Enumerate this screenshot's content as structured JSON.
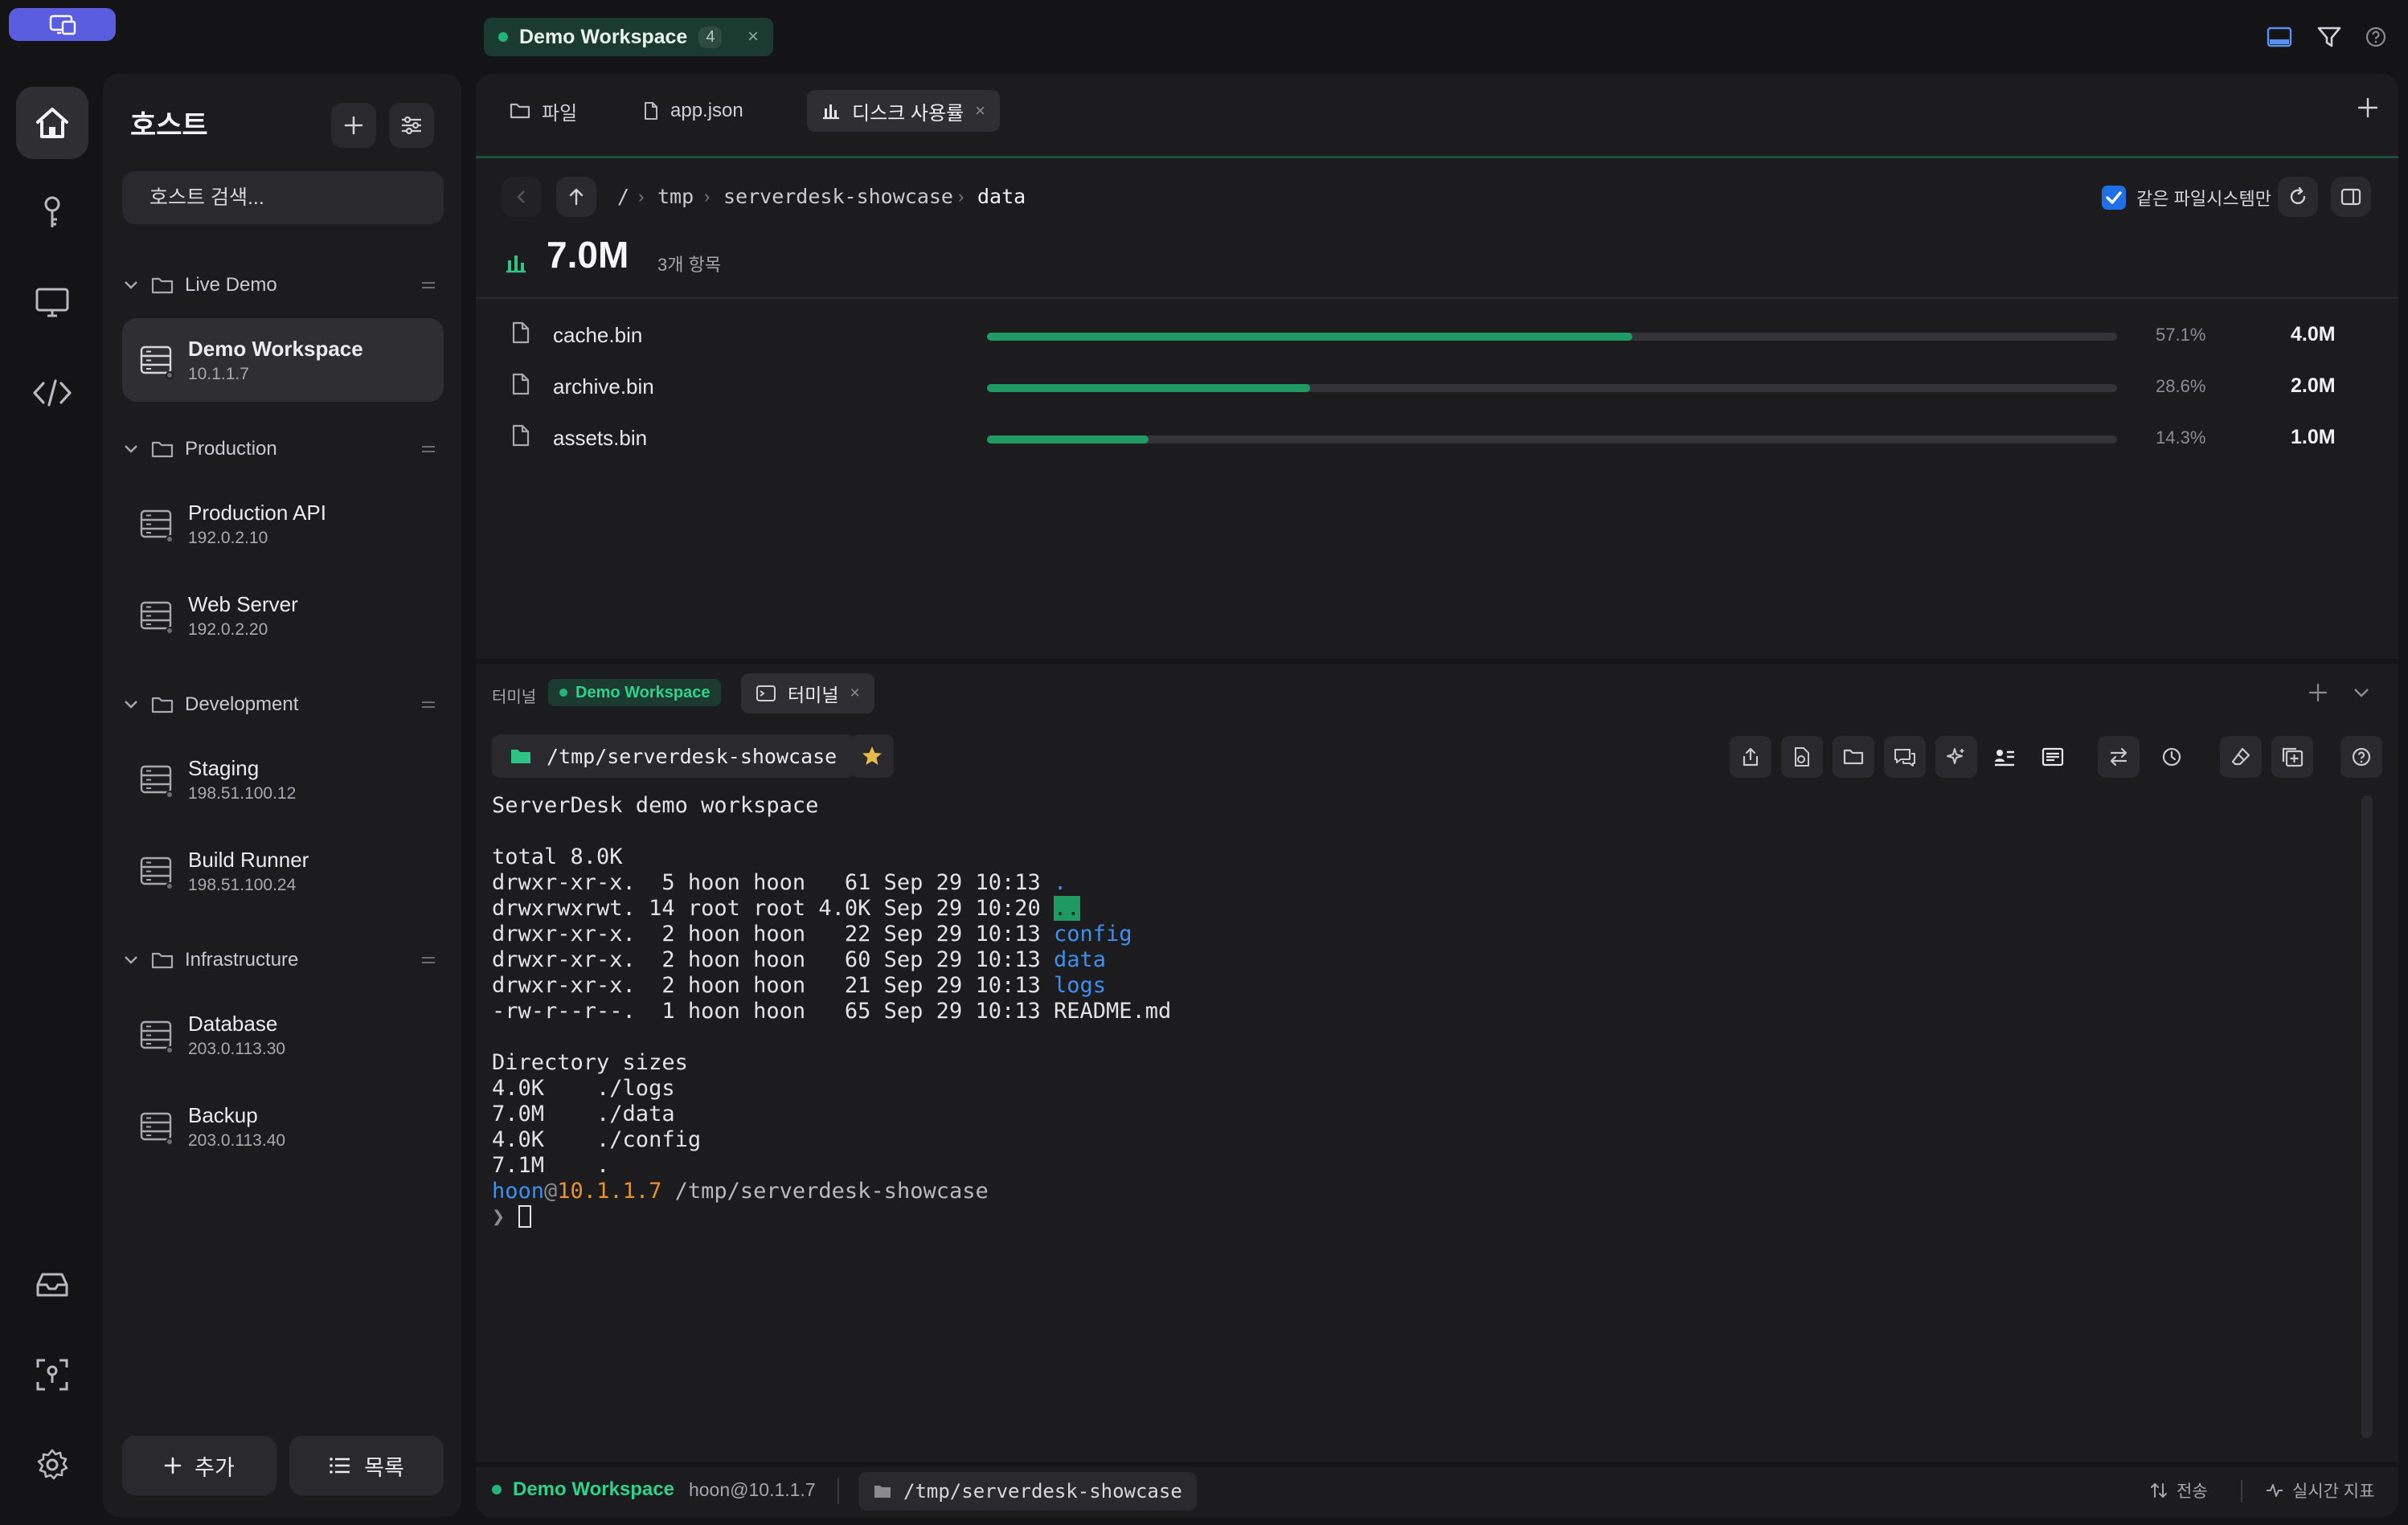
{
  "titlebar": {
    "workspace_tab": {
      "label": "Demo Workspace",
      "count": "4",
      "close": "×"
    }
  },
  "sidebar": {
    "title": "호스트",
    "search_placeholder": "호스트 검색...",
    "groups": [
      {
        "label": "Live Demo",
        "hosts": [
          {
            "name": "Demo Workspace",
            "ip": "10.1.1.7"
          }
        ]
      },
      {
        "label": "Production",
        "hosts": [
          {
            "name": "Production API",
            "ip": "192.0.2.10"
          },
          {
            "name": "Web Server",
            "ip": "192.0.2.20"
          }
        ]
      },
      {
        "label": "Development",
        "hosts": [
          {
            "name": "Staging",
            "ip": "198.51.100.12"
          },
          {
            "name": "Build Runner",
            "ip": "198.51.100.24"
          }
        ]
      },
      {
        "label": "Infrastructure",
        "hosts": [
          {
            "name": "Database",
            "ip": "203.0.113.30"
          },
          {
            "name": "Backup",
            "ip": "203.0.113.40"
          }
        ]
      }
    ],
    "add_button": "추가",
    "list_button": "목록"
  },
  "tabs": [
    {
      "label": "파일",
      "icon": "folder-icon"
    },
    {
      "label": "app.json",
      "icon": "file-icon"
    },
    {
      "label": "디스크 사용률",
      "icon": "bar-chart-icon",
      "close": "×"
    }
  ],
  "disk": {
    "breadcrumb": [
      "/",
      "tmp",
      "serverdesk-showcase",
      "data"
    ],
    "same_fs_label": "같은 파일시스템만",
    "same_fs_checked": true,
    "total_size": "7.0M",
    "item_count": "3개 항목",
    "rows": [
      {
        "name": "cache.bin",
        "percent": "57.1%",
        "fraction": 0.571,
        "size": "4.0M"
      },
      {
        "name": "archive.bin",
        "percent": "28.6%",
        "fraction": 0.286,
        "size": "2.0M"
      },
      {
        "name": "assets.bin",
        "percent": "14.3%",
        "fraction": 0.143,
        "size": "1.0M"
      }
    ],
    "bar_color": "#1f9a63"
  },
  "terminal": {
    "label": "터미널",
    "workspace_chip": "Demo Workspace",
    "tab_label": "터미널",
    "tab_close": "×",
    "cwd": "/tmp/serverdesk-showcase",
    "lines": {
      "banner": "ServerDesk demo workspace",
      "total": "total 8.0K",
      "l1": "drwxr-xr-x.  5 hoon hoon   61 Sep 29 10:13 ",
      "l1_name": ".",
      "l2": "drwxrwxrwt. 14 root root 4.0K Sep 29 10:20 ",
      "l2_name": "..",
      "l3": "drwxr-xr-x.  2 hoon hoon   22 Sep 29 10:13 ",
      "l3_name": "config",
      "l4": "drwxr-xr-x.  2 hoon hoon   60 Sep 29 10:13 ",
      "l4_name": "data",
      "l5": "drwxr-xr-x.  2 hoon hoon   21 Sep 29 10:13 ",
      "l5_name": "logs",
      "l6": "-rw-r--r--.  1 hoon hoon   65 Sep 29 10:13 README.md",
      "dir_sizes": "Directory sizes",
      "d1": "4.0K    ./logs",
      "d2": "7.0M    ./data",
      "d3": "4.0K    ./config",
      "d4": "7.1M    .",
      "prompt_user": "hoon",
      "prompt_at": "@",
      "prompt_host": "10.1.1.7",
      "prompt_path": " /tmp/serverdesk-showcase",
      "prompt_char": "❯ "
    }
  },
  "statusbar": {
    "workspace": "Demo Workspace",
    "user": "hoon@10.1.1.7",
    "path": "/tmp/serverdesk-showcase",
    "transfer": "전송",
    "metrics": "실시간 지표"
  }
}
